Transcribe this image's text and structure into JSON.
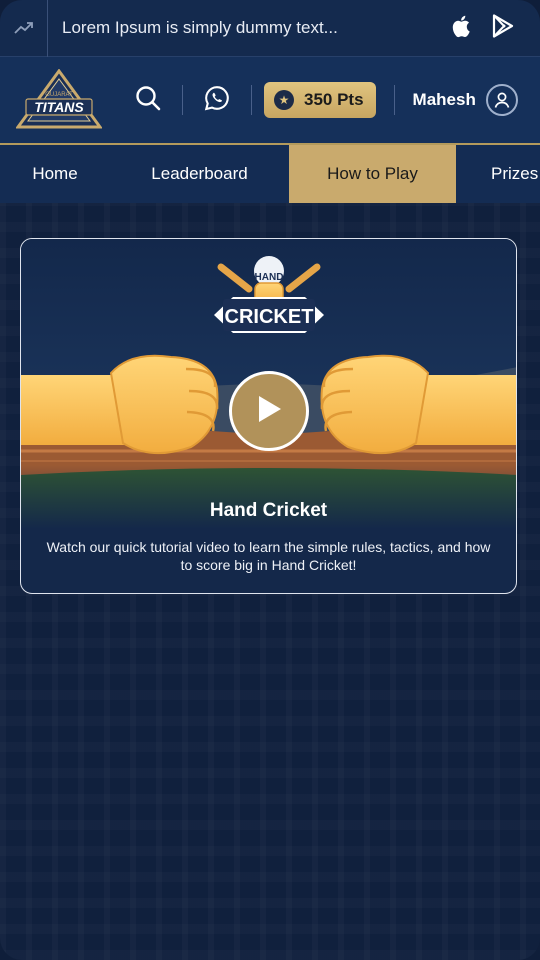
{
  "ticker": {
    "text": "Lorem Ipsum is simply dummy text...",
    "trend_icon": "trend-up-icon",
    "store_icons": [
      "apple-icon",
      "google-play-icon"
    ]
  },
  "header": {
    "logo_text": "TITANS",
    "logo_subtext": "GUJARAT",
    "points": "350 Pts",
    "user_name": "Mahesh"
  },
  "nav": {
    "items": [
      {
        "label": "Home"
      },
      {
        "label": "Leaderboard"
      },
      {
        "label": "How to Play"
      },
      {
        "label": "Prizes"
      }
    ],
    "active": "How to Play"
  },
  "card": {
    "badge_top": "HAND",
    "badge_main": "CRICKET",
    "title": "Hand Cricket",
    "description": "Watch our quick tutorial video to learn the simple rules, tactics, and how to score big in Hand Cricket!"
  },
  "colors": {
    "gold": "#c9aa6d",
    "navy": "#10203d",
    "header": "#15305a"
  }
}
